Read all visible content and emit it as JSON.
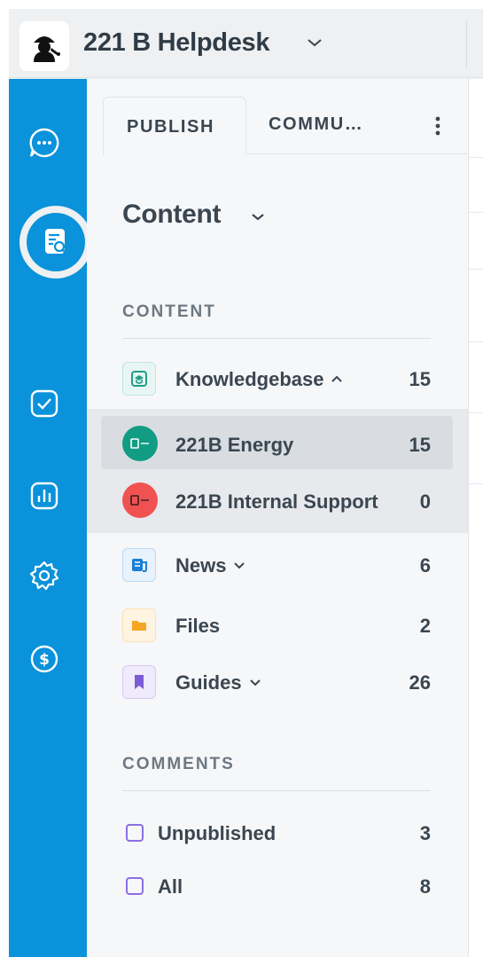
{
  "header": {
    "title": "221 B Helpdesk"
  },
  "rail": {
    "items": [
      {
        "name": "chat-icon"
      },
      {
        "name": "user-icon"
      },
      {
        "name": "content-search-icon",
        "active": true
      },
      {
        "name": "checkbox-icon"
      },
      {
        "name": "analytics-icon"
      },
      {
        "name": "gear-icon"
      },
      {
        "name": "dollar-icon"
      }
    ]
  },
  "tabs": {
    "publish": "PUBLISH",
    "community": "COMMU…"
  },
  "section": {
    "title": "Content"
  },
  "content_group": {
    "label": "CONTENT",
    "items": [
      {
        "label": "Knowledgebase",
        "count": "15",
        "icon": "graduation-cap-icon",
        "color": "#1f9e8a"
      },
      {
        "label": "221B Energy",
        "count": "15",
        "icon": "brand-logo-icon",
        "color": "#129c84"
      },
      {
        "label": "221B Internal Support",
        "count": "0",
        "icon": "brand-logo-icon",
        "color": "#f05252"
      },
      {
        "label": "News",
        "count": "6",
        "icon": "news-icon",
        "color": "#1a7fd6"
      },
      {
        "label": "Files",
        "count": "2",
        "icon": "folder-icon",
        "color": "#f5a623"
      },
      {
        "label": "Guides",
        "count": "26",
        "icon": "bookmark-icon",
        "color": "#7b5cd6"
      }
    ]
  },
  "comments_group": {
    "label": "COMMENTS",
    "items": [
      {
        "label": "Unpublished",
        "count": "3"
      },
      {
        "label": "All",
        "count": "8"
      }
    ]
  },
  "colors": {
    "rail": "#0a92da",
    "panel": "#f6f7f8",
    "text": "#3a4651"
  }
}
